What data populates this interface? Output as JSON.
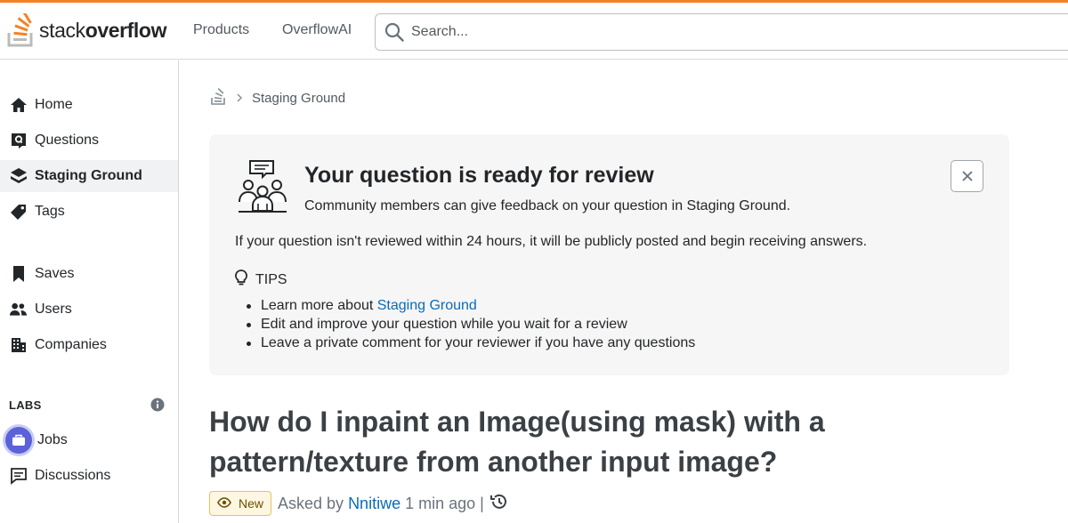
{
  "colors": {
    "accent": "#f48225",
    "link": "#0a6bb8",
    "jobs": "#5b61d8"
  },
  "header": {
    "logo": {
      "word1": "stack",
      "word2": "overflow",
      "icon": "stack-overflow-logo-icon"
    },
    "nav": {
      "products": "Products",
      "overflowai": "OverflowAI"
    },
    "search": {
      "placeholder": "Search...",
      "icon": "search-icon"
    }
  },
  "sidebar": {
    "items": [
      {
        "label": "Home",
        "icon": "home-icon"
      },
      {
        "label": "Questions",
        "icon": "questions-icon"
      },
      {
        "label": "Staging Ground",
        "icon": "staging-ground-icon",
        "active": true
      },
      {
        "label": "Tags",
        "icon": "tag-icon"
      },
      {
        "label": "Saves",
        "icon": "bookmark-icon"
      },
      {
        "label": "Users",
        "icon": "users-icon"
      },
      {
        "label": "Companies",
        "icon": "building-icon"
      }
    ],
    "labs": {
      "heading": "LABS",
      "info_icon": "info-icon"
    },
    "labs_items": [
      {
        "label": "Jobs",
        "icon": "briefcase-icon"
      },
      {
        "label": "Discussions",
        "icon": "discussions-icon"
      }
    ]
  },
  "breadcrumb": {
    "icon": "stack-overflow-icon",
    "separator_icon": "chevron-right-icon",
    "current": "Staging Ground"
  },
  "review_card": {
    "title": "Your question is ready for review",
    "subtitle": "Community members can give feedback on your question in Staging Ground.",
    "note": "If your question isn't reviewed within 24 hours, it will be publicly posted and begin receiving answers.",
    "tips_heading": "TIPS",
    "tips": [
      {
        "text": "Learn more about ",
        "link": "Staging Ground"
      },
      {
        "text": "Edit and improve your question while you wait for a review"
      },
      {
        "text": "Leave a private comment for your reviewer if you have any questions"
      }
    ]
  },
  "question": {
    "title": "How do I inpaint an Image(using mask) with a pattern/texture from another input image?",
    "badge": "New",
    "asked_by_prefix": "Asked by",
    "author": "Nnitiwe",
    "time": "1 min ago",
    "separator": "|"
  }
}
